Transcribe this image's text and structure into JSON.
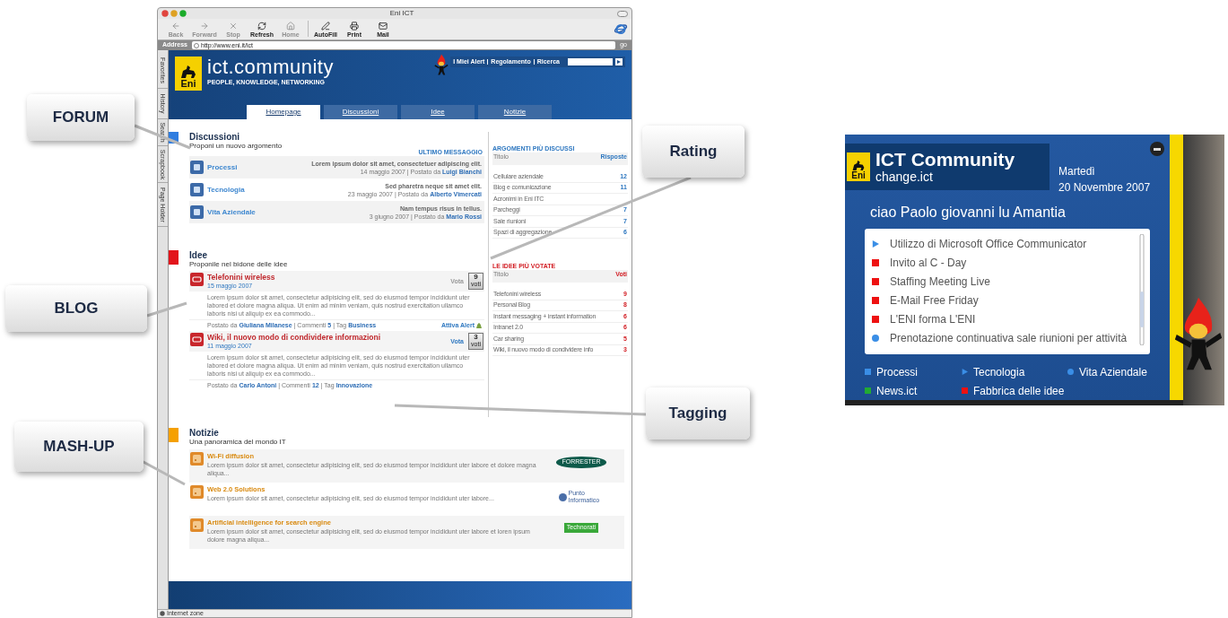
{
  "callouts": [
    {
      "text": "FORUM"
    },
    {
      "text": "BLOG"
    },
    {
      "text": "MASH-UP"
    },
    {
      "text": "Rating"
    },
    {
      "text": "Tagging"
    }
  ],
  "browser": {
    "title": "Eni ICT",
    "toolbar": [
      {
        "label": "Back",
        "disabled": true
      },
      {
        "label": "Forward",
        "disabled": true
      },
      {
        "label": "Stop",
        "disabled": true
      },
      {
        "label": "Refresh",
        "disabled": false
      },
      {
        "label": "Home",
        "disabled": true
      },
      {
        "label": "AutoFill",
        "disabled": false
      },
      {
        "label": "Print",
        "disabled": false
      },
      {
        "label": "Mail",
        "disabled": false
      }
    ],
    "address_label": "Address",
    "url": "http://www.eni.it/ict",
    "go": "go",
    "side_tabs": [
      "Favorites",
      "History",
      "Search",
      "Scrapbook",
      "Page Holder"
    ],
    "status": "Internet zone"
  },
  "site": {
    "logo": "Eni",
    "brand": "ict.community",
    "tagline": "PEOPLE, KNOWLEDGE, NETWORKING",
    "top_links": [
      "I Miei Alert",
      "Regolamento",
      "Ricerca"
    ],
    "tabs": [
      {
        "label": "Homepage",
        "selected": true
      },
      {
        "label": "Discussioni",
        "selected": false
      },
      {
        "label": "Idee",
        "selected": false
      },
      {
        "label": "Notizie",
        "selected": false
      }
    ],
    "discussioni": {
      "title": "Discussioni",
      "subtitle": "Proponi un nuovo argomento",
      "column_header": "ULTIMO MESSAGGIO",
      "items": [
        {
          "name": "Processi",
          "excerpt": "Lorem ipsum dolor sit amet, consectetuer adipiscing elit.",
          "date": "14 maggio 2007 | Postato da",
          "author": "Luigi Bianchi"
        },
        {
          "name": "Tecnologia",
          "excerpt": "Sed pharetra neque sit amet elit.",
          "date": "23 maggio 2007 | Postato da",
          "author": "Alberto Vimercati"
        },
        {
          "name": "Vita Aziendale",
          "excerpt": "Nam tempus risus in tellus.",
          "date": "3 giugno 2007 | Postato da",
          "author": "Mario Rossi"
        }
      ]
    },
    "argomenti": {
      "title": "ARGOMENTI PIÙ DISCUSSI",
      "columns": [
        "Titolo",
        "Risposte"
      ],
      "rows": [
        {
          "title": "Cellulare aziendale",
          "count": "12"
        },
        {
          "title": "Blog e comunicazione",
          "count": "11"
        },
        {
          "title": "Acronimi in Eni ITC"
        },
        {
          "title": "Parcheggi",
          "count": "7"
        },
        {
          "title": "Sale riunioni",
          "count": "7"
        },
        {
          "title": "Spazi di aggregazione",
          "count": "6"
        }
      ]
    },
    "idee": {
      "title": "Idee",
      "subtitle": "Proponile nel bidone delle idee",
      "items": [
        {
          "title": "Telefonini wireless",
          "date": "15 maggio 2007",
          "vote": "Vota",
          "vote_disabled": true,
          "votes": "9",
          "votes_label": "voti",
          "body": "Lorem ipsum dolor sit amet, consectetur adipisicing elit, sed do eiusmod tempor incididunt uter labored et dolore magna aliqua. Ut enim ad minim veniam, quis nostrud exercitation ullamco laboris nisi ut aliquip ex ea commodo...",
          "posted": "Postato da",
          "author": "Giuliana Milanese",
          "comments_label": "| Commenti",
          "comments": "5",
          "tag_label": "| Tag",
          "tag": "Business",
          "alert": "Attiva Alert"
        },
        {
          "title": "Wiki, il nuovo modo di condividere informazioni",
          "date": "11 maggio 2007",
          "vote": "Vota",
          "vote_disabled": false,
          "votes": "3",
          "votes_label": "voti",
          "body": "Lorem ipsum dolor sit amet, consectetur adipisicing elit, sed do eiusmod tempor incididunt uter labored et dolore magna aliqua. Ut enim ad minim veniam, quis nostrud exercitation ullamco laboris nisi ut aliquip ex ea commodo...",
          "posted": "Postato da",
          "author": "Carlo Antoni",
          "comments_label": "| Commenti",
          "comments": "12",
          "tag_label": "| Tag",
          "tag": "Innovazione"
        }
      ]
    },
    "votate": {
      "title": "LE IDEE PIÙ VOTATE",
      "columns": [
        "Titolo",
        "Voti"
      ],
      "rows": [
        {
          "title": "Telefonini wireless",
          "count": "9"
        },
        {
          "title": "Personal Blog",
          "count": "8"
        },
        {
          "title": "Instant messaging + instant information",
          "count": "6"
        },
        {
          "title": "Intranet 2.0",
          "count": "6"
        },
        {
          "title": "Car sharing",
          "count": "5"
        },
        {
          "title": "Wiki, il nuovo modo di condividere info",
          "count": "3"
        }
      ]
    },
    "notizie": {
      "title": "Notizie",
      "subtitle": "Una panoramica del mondo IT",
      "items": [
        {
          "title": "Wi-Fi diffusion",
          "body": "Lorem ipsum dolor sit amet, consectetur adipisicing elit, sed do eiusmod tempor incididunt uter labore et dolore magna aliqua...",
          "source": "FORRESTER",
          "kind": "oval"
        },
        {
          "title": "Web 2.0 Solutions",
          "body": "Lorem ipsum dolor sit amet, consectetur adipisicing elit, sed do eiusmod tempor incididunt uter labore...",
          "source": "Punto Informatico",
          "kind": "globe"
        },
        {
          "title": "Artificial intelligence for search engine",
          "body": "Lorem ipsum dolor sit amet, consectetur adipisicing elit, sed do eiusmod tempor incididunt uter labore et loren ipsum dolore magna aliqua...",
          "source": "Technorati",
          "kind": "tag"
        }
      ]
    }
  },
  "widget": {
    "logo": "Eni",
    "title": "ICT Community",
    "subtitle": "change.ict",
    "day": "Martedì",
    "date": "20 Novembre 2007",
    "greeting": "ciao Paolo giovanni lu Amantia",
    "items": [
      {
        "text": "Utilizzo di Microsoft Office Communicator",
        "kind": "triangle",
        "color": "#3a8ee6"
      },
      {
        "text": "Invito al C - Day",
        "kind": "square",
        "color": "#ee1111"
      },
      {
        "text": "Staffing Meeting Live",
        "kind": "square",
        "color": "#ee1111"
      },
      {
        "text": "E-Mail Free Friday",
        "kind": "square",
        "color": "#ee1111"
      },
      {
        "text": "L'ENI forma L'ENI",
        "kind": "square",
        "color": "#ee1111"
      },
      {
        "text": "Prenotazione continuativa sale riunioni per attività",
        "kind": "circle",
        "color": "#3a8ee6"
      }
    ],
    "legend": [
      {
        "label": "Processi",
        "kind": "square",
        "color": "#3a8ee6"
      },
      {
        "label": "Tecnologia",
        "kind": "triangle",
        "color": "#3a8ee6"
      },
      {
        "label": "Vita Aziendale",
        "kind": "circle",
        "color": "#3a8ee6"
      },
      {
        "label": "News.ict",
        "kind": "square",
        "color": "#22aa33"
      },
      {
        "label": "Fabbrica delle idee",
        "kind": "square",
        "color": "#ee1111"
      }
    ]
  }
}
